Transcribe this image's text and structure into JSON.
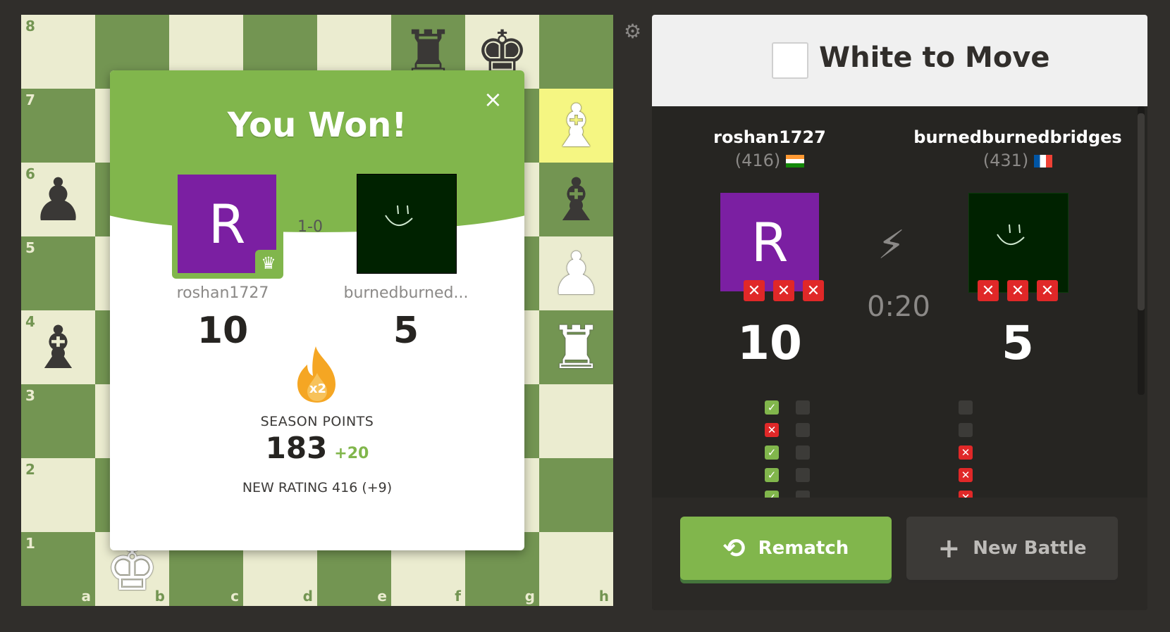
{
  "board": {
    "ranks": [
      "8",
      "7",
      "6",
      "5",
      "4",
      "3",
      "2",
      "1"
    ],
    "files": [
      "a",
      "b",
      "c",
      "d",
      "e",
      "f",
      "g",
      "h"
    ],
    "highlight_squares": [
      "h7"
    ],
    "pieces": [
      {
        "square": "f8",
        "color": "black",
        "glyph": "♜",
        "name": "rook"
      },
      {
        "square": "g8",
        "color": "black",
        "glyph": "♚",
        "name": "king"
      },
      {
        "square": "h7",
        "color": "white",
        "glyph": "♝",
        "name": "bishop"
      },
      {
        "square": "a6",
        "color": "black",
        "glyph": "♟",
        "name": "pawn"
      },
      {
        "square": "h6",
        "color": "black",
        "glyph": "♝",
        "name": "bishop"
      },
      {
        "square": "h5",
        "color": "white",
        "glyph": "♟",
        "name": "pawn"
      },
      {
        "square": "a4",
        "color": "black",
        "glyph": "♝",
        "name": "bishop"
      },
      {
        "square": "h4",
        "color": "white",
        "glyph": "♜",
        "name": "rook"
      },
      {
        "square": "b1",
        "color": "white",
        "glyph": "♚",
        "name": "king"
      }
    ]
  },
  "settings_icon": "gear-icon",
  "modal": {
    "title": "You Won!",
    "close_label": "×",
    "score": "1-0",
    "player1": {
      "name": "roshan1727",
      "initial": "R",
      "points": "10",
      "avatar_color": "#7b1fa2"
    },
    "player2": {
      "name": "burnedburned...",
      "points": "5",
      "avatar_color": "#002200"
    },
    "multiplier": "x2",
    "season_label": "SEASON POINTS",
    "season_points": "183",
    "season_delta": "+20",
    "rating_line": "NEW RATING 416 (+9)"
  },
  "panel": {
    "turn_text": "White to Move",
    "timer": "0:20",
    "player1": {
      "name": "roshan1727",
      "rating": "(416)",
      "initial": "R",
      "points": "10",
      "strikes": 3,
      "history": [
        "ok",
        "x",
        "ok",
        "ok",
        "ok"
      ]
    },
    "player2": {
      "name": "burnedburnedbridges",
      "rating": "(431)",
      "points": "5",
      "strikes": 3,
      "history": [
        "e",
        "e",
        "x",
        "x",
        "x"
      ]
    },
    "rematch_label": "Rematch",
    "new_battle_label": "New Battle"
  },
  "colors": {
    "board_light": "#ebecd0",
    "board_dark": "#739552",
    "highlight": "#f5f682",
    "accent_green": "#81b64c",
    "strike_red": "#e02828",
    "panel_bg": "#262522"
  }
}
